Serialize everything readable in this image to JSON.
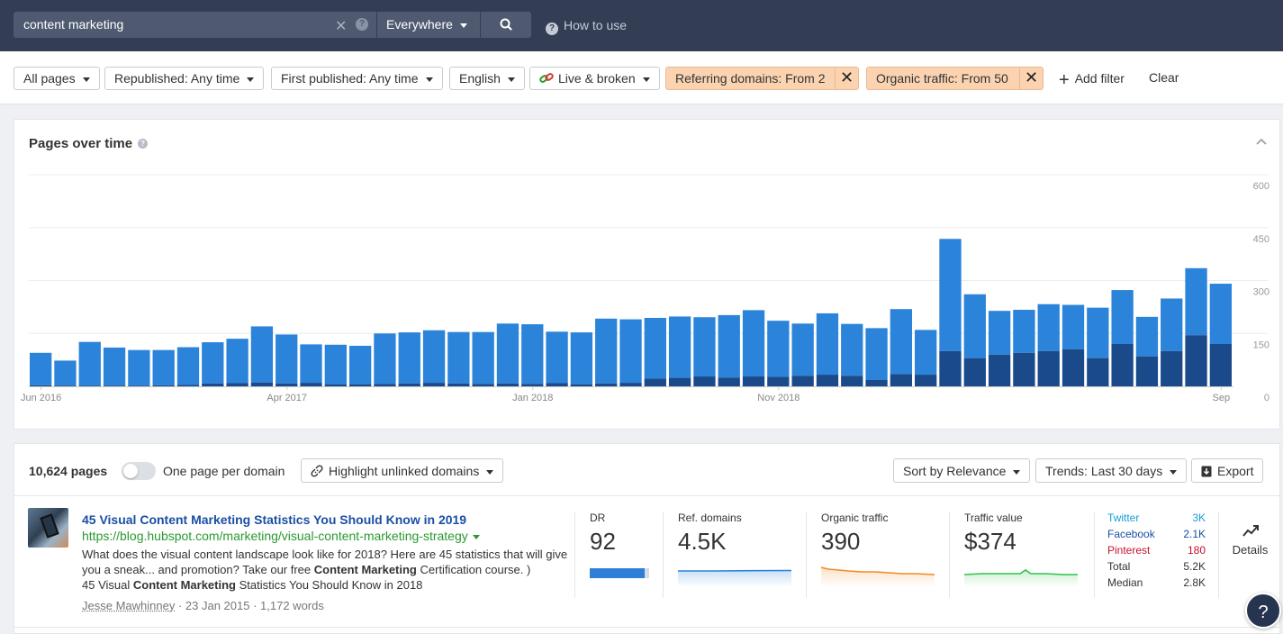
{
  "search": {
    "query": "content marketing",
    "mode": "Everywhere",
    "how_to_use": "How to use"
  },
  "filters": {
    "all_pages": "All pages",
    "republished": "Republished: Any time",
    "first_published": "First published: Any time",
    "language": "English",
    "link_status": "Live & broken",
    "referring_domains": "Referring domains: From 2",
    "organic_traffic": "Organic traffic: From 50",
    "add_filter": "Add filter",
    "clear": "Clear"
  },
  "chart_card": {
    "title": "Pages over time"
  },
  "chart_data": {
    "type": "bar",
    "title": "Pages over time",
    "x_tick_labels": [
      "Jun 2016",
      "Apr 2017",
      "Jan 2018",
      "Nov 2018",
      "Sep"
    ],
    "y_ticks": [
      0,
      150,
      300,
      450,
      600
    ],
    "ylim": [
      0,
      600
    ],
    "stacked": true,
    "series": [
      {
        "color": "#1a4a8a",
        "values": [
          3,
          2,
          2,
          2,
          2,
          3,
          4,
          8,
          9,
          11,
          8,
          10,
          6,
          6,
          7,
          8,
          10,
          8,
          7,
          8,
          7,
          9,
          6,
          8,
          10,
          22,
          24,
          28,
          25,
          28,
          27,
          30,
          33,
          30,
          18,
          35,
          33,
          100,
          80,
          90,
          95,
          100,
          105,
          80,
          120,
          85,
          100,
          145,
          120
        ]
      },
      {
        "color": "#2b83da",
        "values": [
          92,
          71,
          124,
          108,
          101,
          100,
          107,
          117,
          126,
          159,
          139,
          109,
          112,
          109,
          143,
          145,
          149,
          146,
          147,
          170,
          169,
          146,
          147,
          184,
          180,
          172,
          174,
          168,
          177,
          188,
          159,
          148,
          174,
          147,
          147,
          184,
          127,
          318,
          181,
          124,
          122,
          133,
          126,
          143,
          153,
          112,
          149,
          190,
          171
        ]
      }
    ],
    "categories": [
      "2016-06",
      "2016-07",
      "2016-08",
      "2016-09",
      "2016-10",
      "2016-11",
      "2016-12",
      "2017-01",
      "2017-02",
      "2017-03",
      "2017-04",
      "2017-05",
      "2017-06",
      "2017-07",
      "2017-08",
      "2017-09",
      "2017-10",
      "2017-11",
      "2017-12",
      "2018-01",
      "2018-02",
      "2018-03",
      "2018-04",
      "2018-05",
      "2018-06",
      "2018-07",
      "2018-08",
      "2018-09",
      "2018-10",
      "2018-11",
      "2018-12",
      "2019-01",
      "2019-02",
      "2019-03",
      "2019-04",
      "2019-05",
      "2019-06",
      "2019-07",
      "2019-08",
      "2019-09"
    ]
  },
  "results_header": {
    "count": "10,624 pages",
    "one_per_domain": "One page per domain",
    "highlight": "Highlight unlinked domains",
    "sort": "Sort by Relevance",
    "trends": "Trends: Last 30 days",
    "export": "Export"
  },
  "result": {
    "title": "45 Visual Content Marketing Statistics You Should Know in 2019",
    "url": "https://blog.hubspot.com/marketing/visual-content-marketing-strategy",
    "snippet_1": "What does the visual content landscape look like for 2018? Here are 45 statistics that will give you a sneak... and promotion? Take our free ",
    "snippet_b1": "Content Marketing",
    "snippet_2": " Certification course. )",
    "snippet_3": "45 Visual ",
    "snippet_b2": "Content Marketing",
    "snippet_4": " Statistics You Should Know in 2018",
    "author": "Jesse Mawhinney",
    "date": "23 Jan 2015",
    "words": "1,172 words",
    "dr_label": "DR",
    "dr_value": "92",
    "dr_fill": 0.92,
    "ref_label": "Ref. domains",
    "ref_value": "4.5K",
    "org_label": "Organic traffic",
    "org_value": "390",
    "tv_label": "Traffic value",
    "tv_value": "$374",
    "social": [
      {
        "name": "Twitter",
        "value": "3K",
        "color": "#1a9bd9"
      },
      {
        "name": "Facebook",
        "value": "2.1K",
        "color": "#1a4fa3"
      },
      {
        "name": "Pinterest",
        "value": "180",
        "color": "#c8102e"
      },
      {
        "name": "Total",
        "value": "5.2K",
        "color": "#333333"
      },
      {
        "name": "Median",
        "value": "2.8K",
        "color": "#333333"
      }
    ],
    "details": "Details"
  },
  "help_fab": "?"
}
